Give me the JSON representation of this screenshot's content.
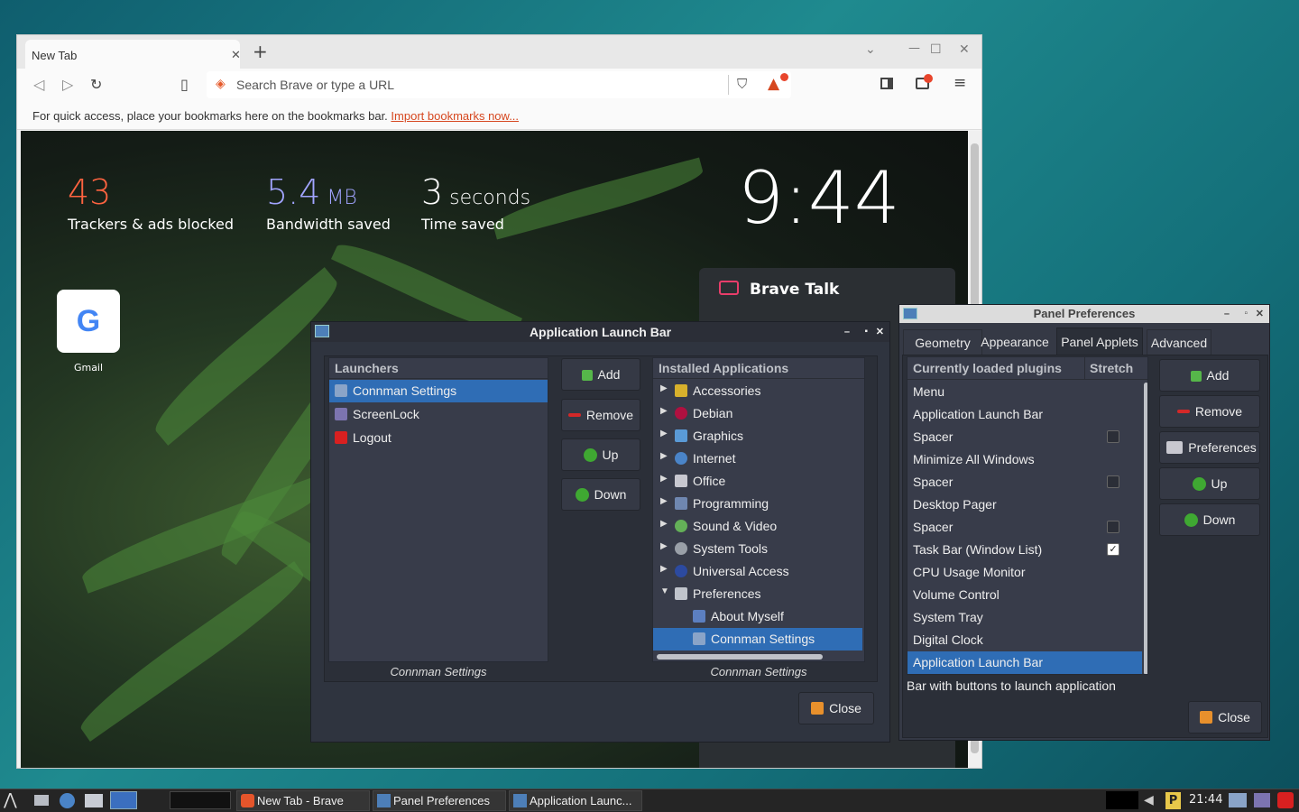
{
  "browser": {
    "tab_title": "New Tab",
    "tab_close": "✕",
    "new_tab": "+",
    "url_placeholder": "Search Brave or type a URL",
    "bookmarks_hint": "For quick access, place your bookmarks here on the bookmarks bar. ",
    "import_link": "Import bookmarks now...",
    "stats": [
      {
        "value": "43",
        "unit": "",
        "label": "Trackers & ads blocked",
        "color": "#ff6340"
      },
      {
        "value": "5.4",
        "unit": " MB",
        "label": "Bandwidth saved",
        "color": "#a1a4ff"
      },
      {
        "value": "3",
        "unit": " seconds",
        "label": "Time saved",
        "color": "#ffffff"
      }
    ],
    "clock": "9:44",
    "top_site": {
      "letter": "G",
      "label": "Gmail"
    },
    "brave_talk": "Brave Talk"
  },
  "launch_bar": {
    "title": "Application Launch Bar",
    "launchers_header": "Launchers",
    "launchers": [
      "Connman Settings",
      "ScreenLock",
      "Logout"
    ],
    "selected_launcher": "Connman Settings",
    "buttons": {
      "add": "Add",
      "remove": "Remove",
      "up": "Up",
      "down": "Down",
      "close": "Close"
    },
    "installed_header": "Installed Applications",
    "categories": [
      "Accessories",
      "Debian",
      "Graphics",
      "Internet",
      "Office",
      "Programming",
      "Sound & Video",
      "System Tools",
      "Universal Access",
      "Preferences"
    ],
    "pref_children": [
      "About Myself",
      "Connman Settings"
    ],
    "left_caption": "Connman Settings",
    "right_caption": "Connman Settings"
  },
  "panel_prefs": {
    "title": "Panel Preferences",
    "tabs": [
      "Geometry",
      "Appearance",
      "Panel Applets",
      "Advanced"
    ],
    "active_tab": "Panel Applets",
    "col_plugins": "Currently loaded plugins",
    "col_stretch": "Stretch",
    "plugins": [
      {
        "name": "Menu",
        "check": null
      },
      {
        "name": "Application Launch Bar",
        "check": null
      },
      {
        "name": "Spacer",
        "check": false
      },
      {
        "name": "Minimize All Windows",
        "check": null
      },
      {
        "name": "Spacer",
        "check": false
      },
      {
        "name": "Desktop Pager",
        "check": null
      },
      {
        "name": "Spacer",
        "check": false
      },
      {
        "name": "Task Bar (Window List)",
        "check": true
      },
      {
        "name": "CPU Usage Monitor",
        "check": null
      },
      {
        "name": "Volume Control",
        "check": null
      },
      {
        "name": "System Tray",
        "check": null
      },
      {
        "name": "Digital Clock",
        "check": null
      },
      {
        "name": "Application Launch Bar",
        "check": null
      }
    ],
    "description": "Bar with buttons to launch application",
    "buttons": {
      "add": "Add",
      "remove": "Remove",
      "preferences": "Preferences",
      "up": "Up",
      "down": "Down",
      "close": "Close"
    }
  },
  "taskbar": {
    "tasks": [
      "New Tab - Brave",
      "Panel Preferences",
      "Application Launc..."
    ],
    "time": "21:44"
  }
}
